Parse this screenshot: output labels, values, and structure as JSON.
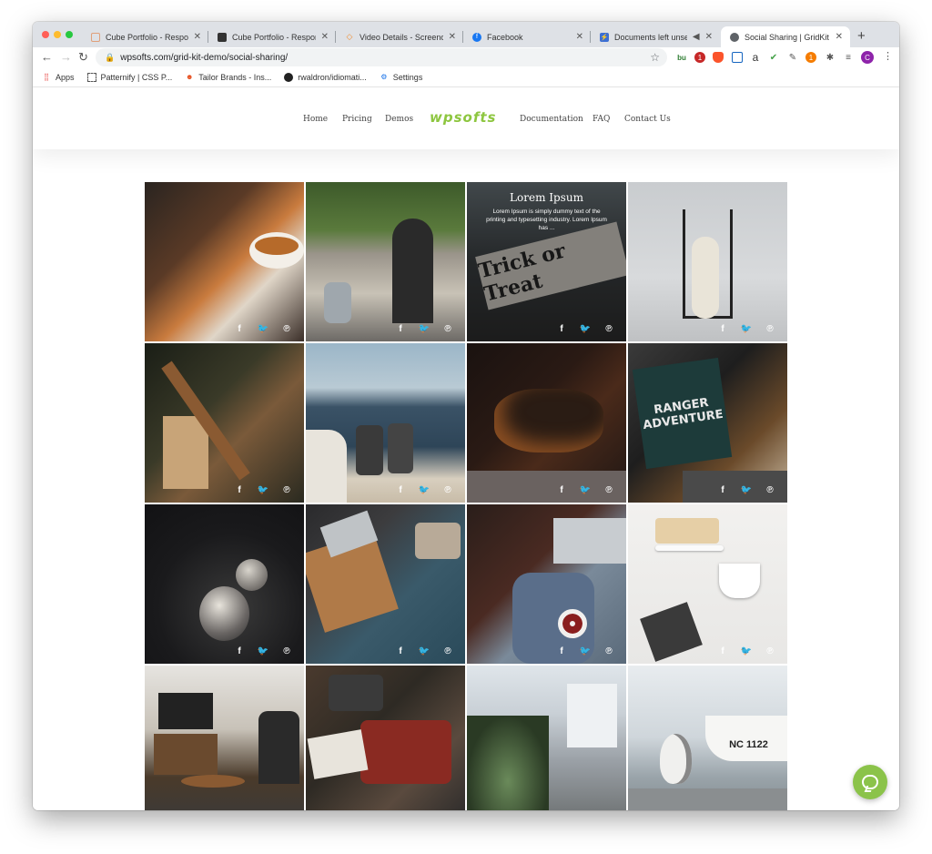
{
  "browser": {
    "tabs": [
      {
        "title": "Cube Portfolio - Responsive",
        "favicon": "grid-icon",
        "color": "#e0a07a"
      },
      {
        "title": "Cube Portfolio - Responsive",
        "favicon": "bird-icon",
        "color": "#333333"
      },
      {
        "title": "Video Details - Screencastify",
        "favicon": "screencastify-icon",
        "color": "#f08c2e"
      },
      {
        "title": "Facebook",
        "favicon": "facebook-icon",
        "color": "#1877f2"
      },
      {
        "title": "Documents left unsecured",
        "favicon": "lightning-icon",
        "color": "#3b6fd4"
      },
      {
        "title": "Social Sharing | GridKit by",
        "favicon": "globe-icon",
        "color": "#5f6368"
      }
    ],
    "url": "wpsofts.com/grid-kit-demo/social-sharing/",
    "profile_initial": "C",
    "extension_badges": [
      "1",
      "1"
    ],
    "bookmarks": [
      {
        "label": "Apps",
        "icon": "apps-grid-icon"
      },
      {
        "label": "Patternify | CSS P...",
        "icon": "pattern-icon"
      },
      {
        "label": "Tailor Brands - Ins...",
        "icon": "tailor-icon"
      },
      {
        "label": "rwaldron/idiomati...",
        "icon": "github-icon"
      },
      {
        "label": "Settings",
        "icon": "gear-icon"
      }
    ]
  },
  "site": {
    "logo": "wpsofts",
    "accent": "#8dc63f",
    "nav": [
      "Home",
      "Pricing",
      "Demos",
      "Documentation",
      "FAQ",
      "Contact Us"
    ]
  },
  "gallery": {
    "hover_title": "Lorem Ipsum",
    "hover_text": "Lorem Ipsum is simply dummy text of the printing and typesetting industry. Lorem Ipsum has ...",
    "share_icons": [
      "facebook-icon",
      "twitter-icon",
      "pinterest-icon"
    ],
    "tiles": [
      "coffee-cup",
      "scooter-door",
      "trick-or-treat-sign",
      "bunny-doll",
      "axe-wood",
      "boats-harbor",
      "sleeping-dog",
      "ranger-pillow-chair",
      "silver-ornament",
      "laptop-coffee-table",
      "jeans-laptop-tea",
      "coffee-cake-stand",
      "living-room-tv",
      "camera-suitcase",
      "street-plant",
      "seagull-boat"
    ]
  },
  "boat_text": "NC 1122",
  "sign_text": "Trick or Treat",
  "pillow_text": "RANGER ADVENTURE"
}
